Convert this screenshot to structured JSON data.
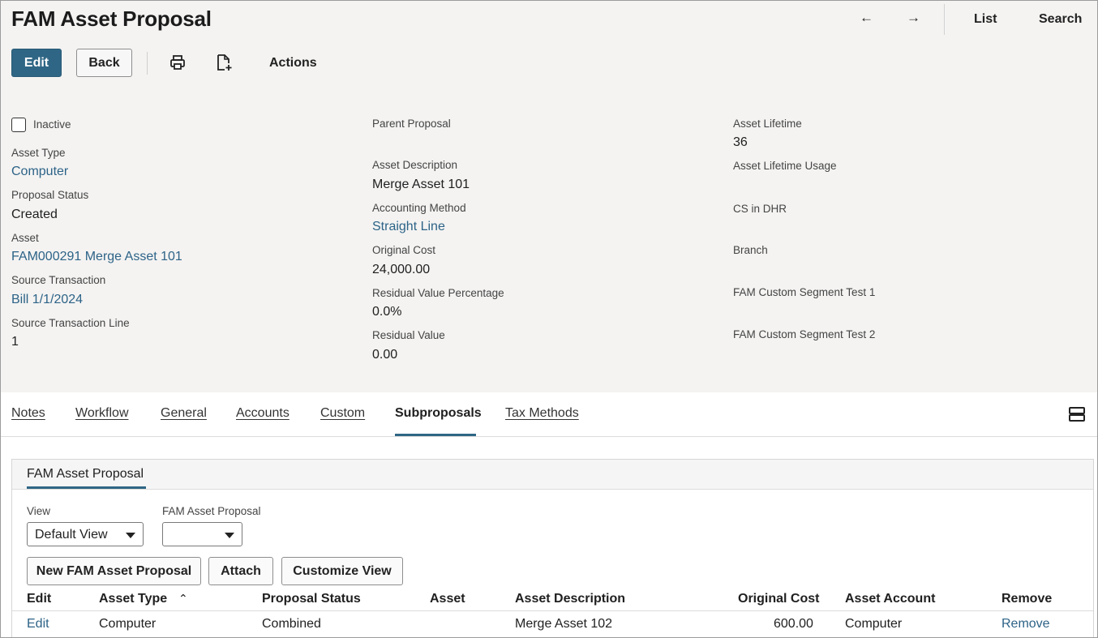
{
  "header": {
    "title": "FAM Asset Proposal",
    "prev_arrow": "←",
    "next_arrow": "→",
    "list_label": "List",
    "search_label": "Search"
  },
  "toolbar": {
    "edit_label": "Edit",
    "back_label": "Back",
    "actions_label": "Actions",
    "print_icon": "print-icon",
    "new_doc_icon": "new-document-icon"
  },
  "fields": {
    "inactive_label": "Inactive",
    "asset_type_label": "Asset Type",
    "asset_type_value": "Computer",
    "proposal_status_label": "Proposal Status",
    "proposal_status_value": "Created",
    "asset_label": "Asset",
    "asset_value": "FAM000291 Merge Asset 101",
    "source_transaction_label": "Source Transaction",
    "source_transaction_value": "Bill 1/1/2024",
    "source_transaction_line_label": "Source Transaction Line",
    "source_transaction_line_value": "1",
    "parent_proposal_label": "Parent Proposal",
    "asset_description_label": "Asset Description",
    "asset_description_value": "Merge Asset 101",
    "accounting_method_label": "Accounting Method",
    "accounting_method_value": "Straight Line",
    "original_cost_label": "Original Cost",
    "original_cost_value": "24,000.00",
    "residual_value_pct_label": "Residual Value Percentage",
    "residual_value_pct_value": "0.0%",
    "residual_value_label": "Residual Value",
    "residual_value_value": "0.00",
    "asset_lifetime_label": "Asset Lifetime",
    "asset_lifetime_value": "36",
    "asset_lifetime_usage_label": "Asset Lifetime Usage",
    "cs_in_dhr_label": "CS in DHR",
    "branch_label": "Branch",
    "fam_custom_segment_1_label": "FAM Custom Segment Test 1",
    "fam_custom_segment_2_label": "FAM Custom Segment Test 2"
  },
  "tabs": {
    "notes": "Notes",
    "workflow": "Workflow",
    "general": "General",
    "accounts": "Accounts",
    "custom": "Custom",
    "subproposals": "Subproposals",
    "tax_methods": "Tax Methods",
    "active": "Subproposals"
  },
  "sublist": {
    "subtab_label": "FAM Asset Proposal",
    "view_label": "View",
    "view_value": "Default View",
    "filter_label": "FAM Asset Proposal",
    "filter_value": "",
    "new_button": "New FAM Asset Proposal",
    "attach_button": "Attach",
    "customize_button": "Customize View",
    "columns": {
      "edit": "Edit",
      "asset_type": "Asset Type",
      "sort_indicator": "⌃",
      "proposal_status": "Proposal Status",
      "asset": "Asset",
      "asset_description": "Asset Description",
      "original_cost": "Original Cost",
      "asset_account": "Asset Account",
      "remove": "Remove"
    },
    "rows": [
      {
        "edit": "Edit",
        "asset_type": "Computer",
        "proposal_status": "Combined",
        "asset": "",
        "asset_description": "Merge Asset 102",
        "original_cost": "600.00",
        "asset_account": "Computer",
        "remove": "Remove"
      }
    ]
  },
  "colors": {
    "primary_button": "#2f6685",
    "link": "#2d6387",
    "background": "#f4f3f2"
  }
}
